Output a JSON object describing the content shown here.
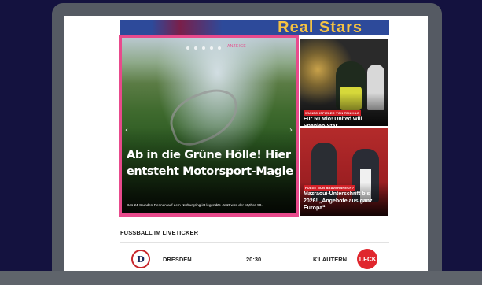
{
  "colors": {
    "background": "#14123f",
    "accent": "#e84a8c",
    "kicker": "#d11f26",
    "banner": "#2d4a9a"
  },
  "banner": {
    "text": "Real Stars"
  },
  "hero": {
    "ad_label": "ANZEIGE",
    "slide_count": 5,
    "title": "Ab in die Grüne Hölle! Hier entsteht Motorsport-Magie",
    "subtitle": "Das 24-Stunden-Rennen auf dem Nürburgring ist legendär. Jetzt wird der Mythos 50.",
    "prev_icon": "chevron-left-icon",
    "next_icon": "chevron-right-icon"
  },
  "cards": [
    {
      "kicker": "WUNSCHSPIELER VON TEN HAG",
      "title": "Für 50 Mio! United will Spanien-Star"
    },
    {
      "kicker": "FOLGT NUN BRAVERBRECH?",
      "title": "Mazraoui-Unterschrift bis 2026! „Angebote aus ganz Europa“"
    }
  ],
  "liveticker": {
    "heading": "FUSSBALL IM LIVETICKER",
    "matches": [
      {
        "home": "DRESDEN",
        "home_crest": "D",
        "time": "20:30",
        "away": "K'LAUTERN",
        "away_crest": "1.FCK"
      }
    ]
  }
}
